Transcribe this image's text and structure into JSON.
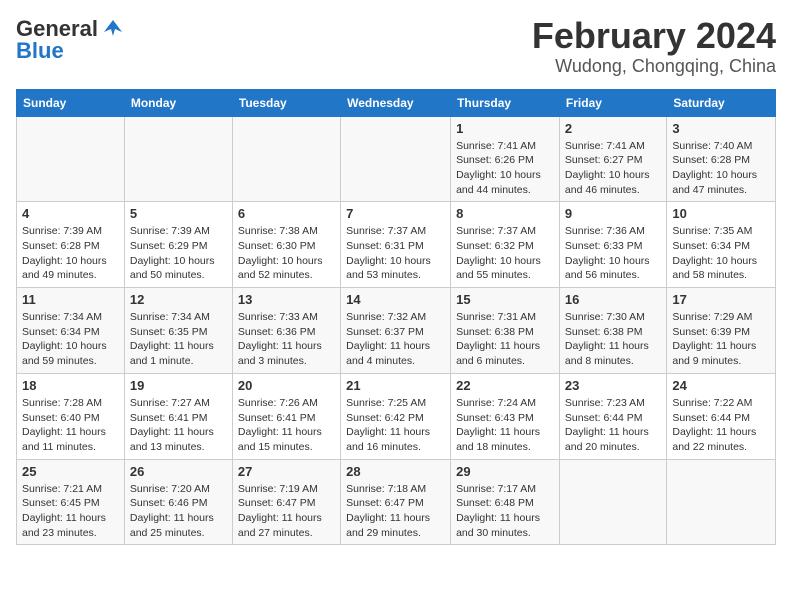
{
  "header": {
    "logo_general": "General",
    "logo_blue": "Blue",
    "month_title": "February 2024",
    "location": "Wudong, Chongqing, China"
  },
  "days_of_week": [
    "Sunday",
    "Monday",
    "Tuesday",
    "Wednesday",
    "Thursday",
    "Friday",
    "Saturday"
  ],
  "weeks": [
    [
      {
        "day": "",
        "detail": ""
      },
      {
        "day": "",
        "detail": ""
      },
      {
        "day": "",
        "detail": ""
      },
      {
        "day": "",
        "detail": ""
      },
      {
        "day": "1",
        "detail": "Sunrise: 7:41 AM\nSunset: 6:26 PM\nDaylight: 10 hours and 44 minutes."
      },
      {
        "day": "2",
        "detail": "Sunrise: 7:41 AM\nSunset: 6:27 PM\nDaylight: 10 hours and 46 minutes."
      },
      {
        "day": "3",
        "detail": "Sunrise: 7:40 AM\nSunset: 6:28 PM\nDaylight: 10 hours and 47 minutes."
      }
    ],
    [
      {
        "day": "4",
        "detail": "Sunrise: 7:39 AM\nSunset: 6:28 PM\nDaylight: 10 hours and 49 minutes."
      },
      {
        "day": "5",
        "detail": "Sunrise: 7:39 AM\nSunset: 6:29 PM\nDaylight: 10 hours and 50 minutes."
      },
      {
        "day": "6",
        "detail": "Sunrise: 7:38 AM\nSunset: 6:30 PM\nDaylight: 10 hours and 52 minutes."
      },
      {
        "day": "7",
        "detail": "Sunrise: 7:37 AM\nSunset: 6:31 PM\nDaylight: 10 hours and 53 minutes."
      },
      {
        "day": "8",
        "detail": "Sunrise: 7:37 AM\nSunset: 6:32 PM\nDaylight: 10 hours and 55 minutes."
      },
      {
        "day": "9",
        "detail": "Sunrise: 7:36 AM\nSunset: 6:33 PM\nDaylight: 10 hours and 56 minutes."
      },
      {
        "day": "10",
        "detail": "Sunrise: 7:35 AM\nSunset: 6:34 PM\nDaylight: 10 hours and 58 minutes."
      }
    ],
    [
      {
        "day": "11",
        "detail": "Sunrise: 7:34 AM\nSunset: 6:34 PM\nDaylight: 10 hours and 59 minutes."
      },
      {
        "day": "12",
        "detail": "Sunrise: 7:34 AM\nSunset: 6:35 PM\nDaylight: 11 hours and 1 minute."
      },
      {
        "day": "13",
        "detail": "Sunrise: 7:33 AM\nSunset: 6:36 PM\nDaylight: 11 hours and 3 minutes."
      },
      {
        "day": "14",
        "detail": "Sunrise: 7:32 AM\nSunset: 6:37 PM\nDaylight: 11 hours and 4 minutes."
      },
      {
        "day": "15",
        "detail": "Sunrise: 7:31 AM\nSunset: 6:38 PM\nDaylight: 11 hours and 6 minutes."
      },
      {
        "day": "16",
        "detail": "Sunrise: 7:30 AM\nSunset: 6:38 PM\nDaylight: 11 hours and 8 minutes."
      },
      {
        "day": "17",
        "detail": "Sunrise: 7:29 AM\nSunset: 6:39 PM\nDaylight: 11 hours and 9 minutes."
      }
    ],
    [
      {
        "day": "18",
        "detail": "Sunrise: 7:28 AM\nSunset: 6:40 PM\nDaylight: 11 hours and 11 minutes."
      },
      {
        "day": "19",
        "detail": "Sunrise: 7:27 AM\nSunset: 6:41 PM\nDaylight: 11 hours and 13 minutes."
      },
      {
        "day": "20",
        "detail": "Sunrise: 7:26 AM\nSunset: 6:41 PM\nDaylight: 11 hours and 15 minutes."
      },
      {
        "day": "21",
        "detail": "Sunrise: 7:25 AM\nSunset: 6:42 PM\nDaylight: 11 hours and 16 minutes."
      },
      {
        "day": "22",
        "detail": "Sunrise: 7:24 AM\nSunset: 6:43 PM\nDaylight: 11 hours and 18 minutes."
      },
      {
        "day": "23",
        "detail": "Sunrise: 7:23 AM\nSunset: 6:44 PM\nDaylight: 11 hours and 20 minutes."
      },
      {
        "day": "24",
        "detail": "Sunrise: 7:22 AM\nSunset: 6:44 PM\nDaylight: 11 hours and 22 minutes."
      }
    ],
    [
      {
        "day": "25",
        "detail": "Sunrise: 7:21 AM\nSunset: 6:45 PM\nDaylight: 11 hours and 23 minutes."
      },
      {
        "day": "26",
        "detail": "Sunrise: 7:20 AM\nSunset: 6:46 PM\nDaylight: 11 hours and 25 minutes."
      },
      {
        "day": "27",
        "detail": "Sunrise: 7:19 AM\nSunset: 6:47 PM\nDaylight: 11 hours and 27 minutes."
      },
      {
        "day": "28",
        "detail": "Sunrise: 7:18 AM\nSunset: 6:47 PM\nDaylight: 11 hours and 29 minutes."
      },
      {
        "day": "29",
        "detail": "Sunrise: 7:17 AM\nSunset: 6:48 PM\nDaylight: 11 hours and 30 minutes."
      },
      {
        "day": "",
        "detail": ""
      },
      {
        "day": "",
        "detail": ""
      }
    ]
  ]
}
